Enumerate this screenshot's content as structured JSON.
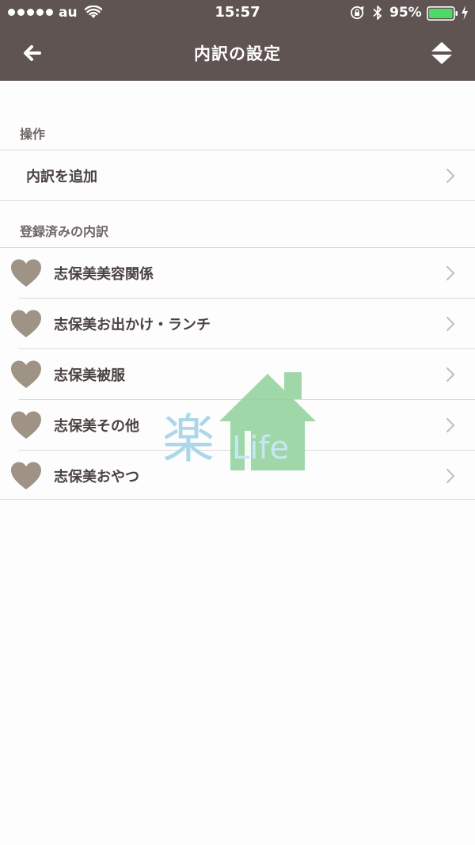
{
  "status_bar": {
    "carrier": "au",
    "time": "15:57",
    "battery_percent": "95%",
    "icons": [
      "signal-dots",
      "wifi-icon",
      "rotation-lock-icon",
      "bluetooth-icon",
      "battery-icon",
      "charging-icon"
    ]
  },
  "nav": {
    "title": "内訳の設定",
    "back_icon": "back-arrow-icon",
    "sort_icon": "sort-updown-icon",
    "color": "#5f5452"
  },
  "operations": {
    "header": "操作",
    "items": [
      {
        "label": "内訳を追加"
      }
    ]
  },
  "registered": {
    "header": "登録済みの内訳",
    "icon": "heart-icon",
    "icon_color": "#9e9385",
    "items": [
      {
        "label": "志保美美容関係"
      },
      {
        "label": "志保美お出かけ・ランチ"
      },
      {
        "label": "志保美被服"
      },
      {
        "label": "志保美その他"
      },
      {
        "label": "志保美おやつ"
      }
    ]
  },
  "watermark": {
    "kanji": "楽",
    "word": "Life",
    "house_color": "#8fd19a"
  }
}
